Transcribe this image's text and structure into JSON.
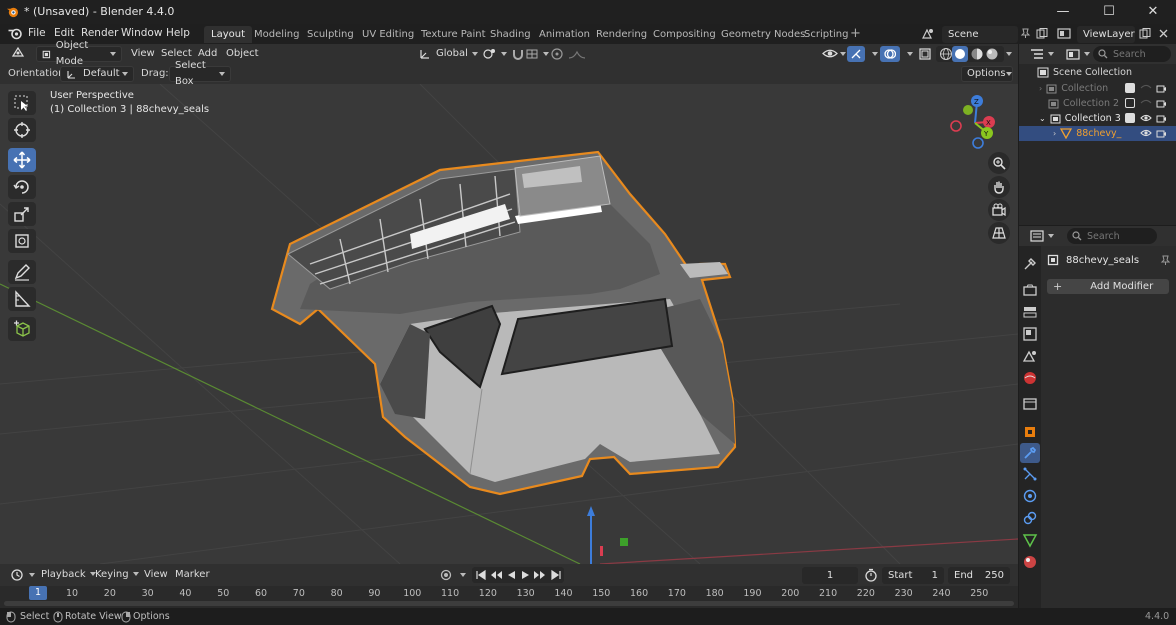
{
  "window": {
    "title": "* (Unsaved) - Blender 4.4.0",
    "minimize": "—",
    "maximize": "☐",
    "close": "✕"
  },
  "menus": [
    "File",
    "Edit",
    "Render",
    "Window",
    "Help"
  ],
  "workspaces": [
    "Layout",
    "Modeling",
    "Sculpting",
    "UV Editing",
    "Texture Paint",
    "Shading",
    "Animation",
    "Rendering",
    "Compositing",
    "Geometry Nodes",
    "Scripting"
  ],
  "workspace_active": "Layout",
  "scene": {
    "label": "Scene",
    "view_layer": "ViewLayer"
  },
  "viewport_header": {
    "mode": "Object Mode",
    "menus": [
      "View",
      "Select",
      "Add",
      "Object"
    ],
    "transform_orientation": "Global"
  },
  "tool_settings": {
    "orientation_label": "Orientation:",
    "orientation_value": "Default",
    "drag_label": "Drag:",
    "drag_value": "Select Box",
    "options": "Options"
  },
  "viewport": {
    "perspective": "User Perspective",
    "collection_info": "(1) Collection 3 | 88chevy_seals",
    "gizmo_axes": {
      "x": "X",
      "y": "Y",
      "z": "Z"
    },
    "colors": {
      "x_axis": "#db3d51",
      "y_axis": "#8ac71f",
      "z_axis": "#3d7ddb",
      "selection_outline": "#e88a1e",
      "grid_green": "#5a8a33"
    }
  },
  "timeline": {
    "menus": [
      "Playback",
      "Keying",
      "View",
      "Marker"
    ],
    "current_frame": "1",
    "start_label": "Start",
    "start": "1",
    "end_label": "End",
    "end": "250",
    "ticks": [
      "10",
      "20",
      "30",
      "40",
      "50",
      "60",
      "70",
      "80",
      "90",
      "100",
      "110",
      "120",
      "130",
      "140",
      "150",
      "160",
      "170",
      "180",
      "190",
      "200",
      "210",
      "220",
      "230",
      "240",
      "250"
    ],
    "playhead": "1"
  },
  "status_bar": {
    "select": "Select",
    "rotate_view": "Rotate View",
    "options": "Options",
    "version": "4.4.0"
  },
  "outliner": {
    "search_placeholder": "Search",
    "scene_collection": "Scene Collection",
    "items": [
      {
        "name": "Collection",
        "enabled": true
      },
      {
        "name": "Collection 2",
        "enabled": false
      },
      {
        "name": "Collection 3",
        "enabled": true
      },
      {
        "name": "88chevy_",
        "enabled": true
      }
    ]
  },
  "properties": {
    "search_placeholder": "Search",
    "object_name": "88chevy_seals",
    "add_modifier": "Add Modifier"
  }
}
